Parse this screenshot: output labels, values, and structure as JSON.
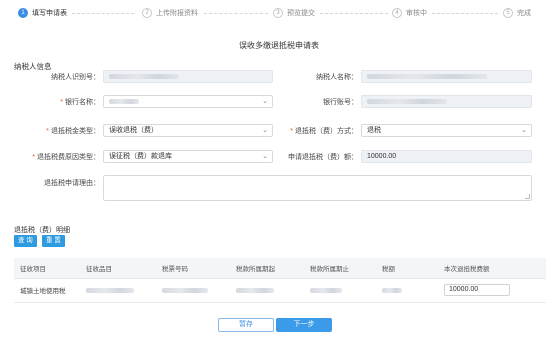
{
  "steps": [
    {
      "num": "1",
      "label": "填写申请表",
      "active": true
    },
    {
      "num": "2",
      "label": "上传附报资料",
      "active": false
    },
    {
      "num": "3",
      "label": "预览提交",
      "active": false
    },
    {
      "num": "4",
      "label": "审核中",
      "active": false
    },
    {
      "num": "5",
      "label": "完成",
      "active": false
    }
  ],
  "form_title": "误收多缴退抵税申请表",
  "taxpayer_section": "纳税人信息",
  "fields": {
    "taxpayer_id_label": "纳税人识别号：",
    "taxpayer_name_label": "纳税人名称：",
    "bank_name_label": "银行名称：",
    "bank_account_label": "银行账号：",
    "refund_type_label": "退抵税金类型：",
    "refund_type_value": "误收退税（费）",
    "refund_method_label": "退抵税（费）方式：",
    "refund_method_value": "退税",
    "source_type_label": "退抵税费原因类型：",
    "source_type_value": "误征税（费）款退库",
    "amount_label": "申请退抵税（费）额：",
    "amount_value": "10000.00",
    "reason_label": "退抵税申请理由："
  },
  "detail": {
    "title": "退抵税（费）明细",
    "query_btn": "查 询",
    "reset_btn": "重 置",
    "columns": [
      "征收项目",
      "征收品目",
      "税票号码",
      "税款所属期起",
      "税款所属期止",
      "税额",
      "本次退抵税费额"
    ],
    "rows": [
      {
        "item": "城镇土地使用税",
        "amount_input": "10000.00"
      }
    ]
  },
  "actions": {
    "save": "暂存",
    "next": "下一步"
  },
  "colors": {
    "accent": "#3a8ee6",
    "button_blue": "#2e9ae0",
    "required": "#e6552d"
  }
}
